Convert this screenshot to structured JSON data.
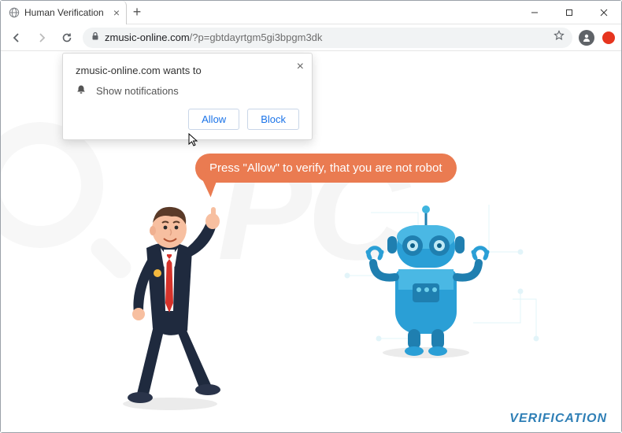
{
  "window": {
    "tab_title": "Human Verification",
    "minimize_tip": "Minimize",
    "maximize_tip": "Maximize",
    "close_tip": "Close"
  },
  "toolbar": {
    "url_host": "zmusic-online.com",
    "url_path": "/?p=gbtdayrtgm5gi3bpgm3dk"
  },
  "permission": {
    "wants_to": "zmusic-online.com wants to",
    "show_notifications": "Show notifications",
    "allow_label": "Allow",
    "block_label": "Block"
  },
  "page": {
    "speech_text": "Press \"Allow\" to verify, that you are not robot",
    "footer_label": "VERIFICATION",
    "watermark_text": "PC"
  },
  "colors": {
    "accent_orange": "#ea7b51",
    "link_blue": "#1a73e8",
    "robot_blue": "#2a9fd6",
    "footer_blue": "#2f7fb6"
  }
}
